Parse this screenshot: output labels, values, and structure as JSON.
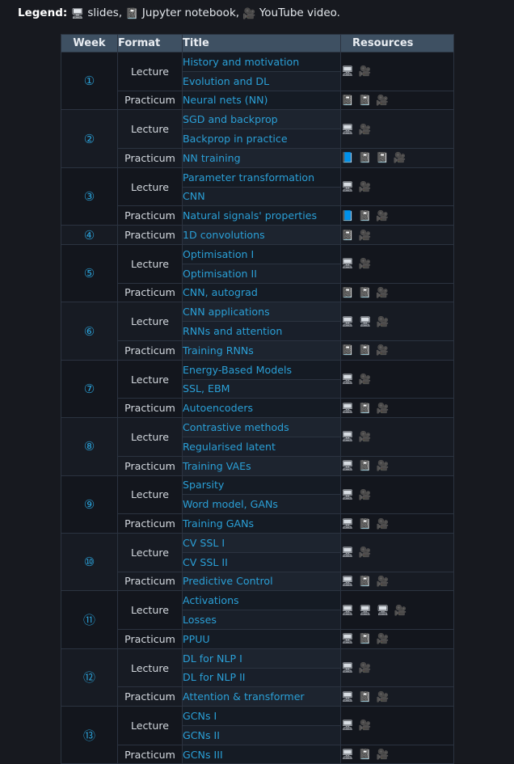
{
  "legend": {
    "label": "Legend:",
    "items": [
      {
        "icon": "🖥",
        "icon_name": "slides-icon",
        "text": "slides,"
      },
      {
        "icon": "📓",
        "icon_name": "jupyter-notebook-icon",
        "text": "Jupyter notebook,"
      },
      {
        "icon": "🎥",
        "icon_name": "youtube-video-icon",
        "text": "YouTube video."
      }
    ]
  },
  "colors": {
    "page_background": "#17191f",
    "header_background": "#3e5062",
    "link": "#2a9fd6",
    "text": "#d8dde3",
    "border": "#2b3340"
  },
  "table": {
    "columns": [
      "Week",
      "Format",
      "Title",
      "Resources"
    ],
    "rows": [
      {
        "week": "①",
        "format": "Lecture",
        "titles": [
          "History and motivation",
          "Evolution and DL"
        ],
        "resources": [
          "🖥",
          "🎥"
        ]
      },
      {
        "week": "",
        "format": "Practicum",
        "titles": [
          "Neural nets (NN)"
        ],
        "resources": [
          "📓",
          "📓",
          "🎥"
        ]
      },
      {
        "week": "②",
        "format": "Lecture",
        "titles": [
          "SGD and backprop",
          "Backprop in practice"
        ],
        "resources": [
          "🖥",
          "🎥"
        ]
      },
      {
        "week": "",
        "format": "Practicum",
        "titles": [
          "NN training"
        ],
        "resources": [
          "📘",
          "📓",
          "📓",
          "🎥"
        ]
      },
      {
        "week": "③",
        "format": "Lecture",
        "titles": [
          "Parameter transformation",
          "CNN"
        ],
        "resources": [
          "🖥",
          "🎥"
        ]
      },
      {
        "week": "",
        "format": "Practicum",
        "titles": [
          "Natural signals' properties"
        ],
        "resources": [
          "📘",
          "📓",
          "🎥"
        ]
      },
      {
        "week": "④",
        "format": "Practicum",
        "titles": [
          "1D convolutions"
        ],
        "resources": [
          "📓",
          "🎥"
        ]
      },
      {
        "week": "⑤",
        "format": "Lecture",
        "titles": [
          "Optimisation I",
          "Optimisation II"
        ],
        "resources": [
          "🖥",
          "🎥"
        ]
      },
      {
        "week": "",
        "format": "Practicum",
        "titles": [
          "CNN, autograd"
        ],
        "resources": [
          "📓",
          "📓",
          "🎥"
        ]
      },
      {
        "week": "⑥",
        "format": "Lecture",
        "titles": [
          "CNN applications",
          "RNNs and attention"
        ],
        "resources": [
          "🖥",
          "🖥",
          "🎥"
        ]
      },
      {
        "week": "",
        "format": "Practicum",
        "titles": [
          "Training RNNs"
        ],
        "resources": [
          "📓",
          "📓",
          "🎥"
        ]
      },
      {
        "week": "⑦",
        "format": "Lecture",
        "titles": [
          "Energy-Based Models",
          "SSL, EBM"
        ],
        "resources": [
          "🖥",
          "🎥"
        ]
      },
      {
        "week": "",
        "format": "Practicum",
        "titles": [
          "Autoencoders"
        ],
        "resources": [
          "🖥",
          "📓",
          "🎥"
        ]
      },
      {
        "week": "⑧",
        "format": "Lecture",
        "titles": [
          "Contrastive methods",
          "Regularised latent"
        ],
        "resources": [
          "🖥",
          "🎥"
        ]
      },
      {
        "week": "",
        "format": "Practicum",
        "titles": [
          "Training VAEs"
        ],
        "resources": [
          "🖥",
          "📓",
          "🎥"
        ]
      },
      {
        "week": "⑨",
        "format": "Lecture",
        "titles": [
          "Sparsity",
          "Word model, GANs"
        ],
        "resources": [
          "🖥",
          "🎥"
        ]
      },
      {
        "week": "",
        "format": "Practicum",
        "titles": [
          "Training GANs"
        ],
        "resources": [
          "🖥",
          "📓",
          "🎥"
        ]
      },
      {
        "week": "⑩",
        "format": "Lecture",
        "titles": [
          "CV SSL I",
          "CV SSL II"
        ],
        "resources": [
          "🖥",
          "🎥"
        ]
      },
      {
        "week": "",
        "format": "Practicum",
        "titles": [
          "Predictive Control"
        ],
        "resources": [
          "🖥",
          "📓",
          "🎥"
        ]
      },
      {
        "week": "⑪",
        "format": "Lecture",
        "titles": [
          "Activations",
          "Losses"
        ],
        "resources": [
          "🖥",
          "🖥",
          "🖥",
          "🎥"
        ]
      },
      {
        "week": "",
        "format": "Practicum",
        "titles": [
          "PPUU"
        ],
        "resources": [
          "🖥",
          "📓",
          "🎥"
        ]
      },
      {
        "week": "⑫",
        "format": "Lecture",
        "titles": [
          "DL for NLP I",
          "DL for NLP II"
        ],
        "resources": [
          "🖥",
          "🎥"
        ]
      },
      {
        "week": "",
        "format": "Practicum",
        "titles": [
          "Attention & transformer"
        ],
        "resources": [
          "🖥",
          "📓",
          "🎥"
        ]
      },
      {
        "week": "⑬",
        "format": "Lecture",
        "titles": [
          "GCNs I",
          "GCNs II"
        ],
        "resources": [
          "🖥",
          "🎥"
        ]
      },
      {
        "week": "",
        "format": "Practicum",
        "titles": [
          "GCNs III"
        ],
        "resources": [
          "🖥",
          "📓",
          "🎥"
        ]
      }
    ]
  }
}
